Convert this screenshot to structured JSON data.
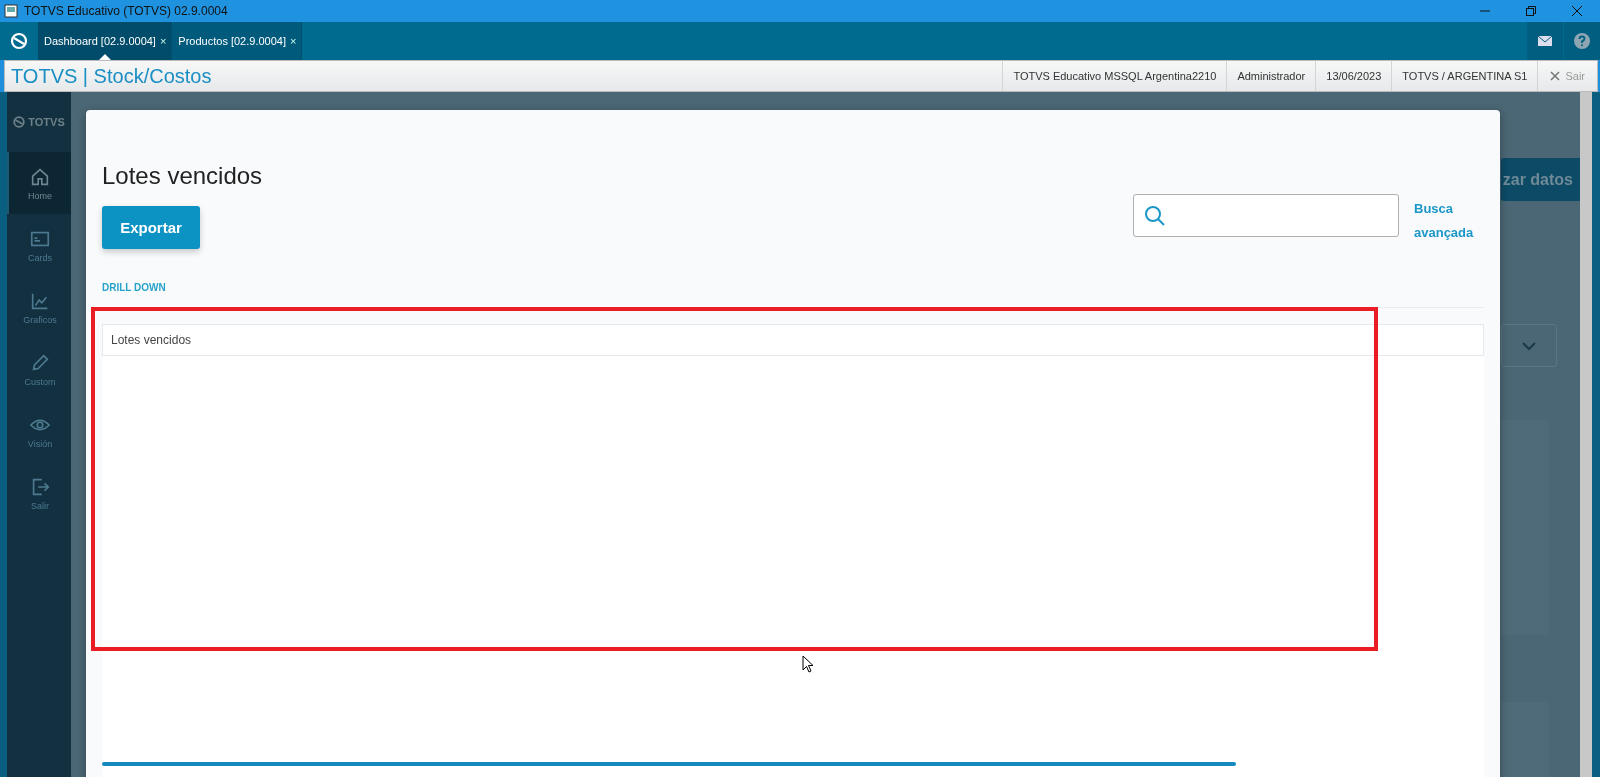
{
  "window": {
    "title": "TOTVS Educativo (TOTVS) 02.9.0004"
  },
  "tabs": [
    {
      "label": "Dashboard [02.9.0004]",
      "close": "×",
      "selected": true
    },
    {
      "label": "Productos [02.9.0004]",
      "close": "×",
      "selected": false
    }
  ],
  "header": {
    "app_title": "TOTVS | Stock/Costos",
    "info": [
      "TOTVS Educativo MSSQL Argentina2210",
      "Administrador",
      "13/06/2023",
      "TOTVS / ARGENTINA S1"
    ],
    "logout": "Sair"
  },
  "sidebar": {
    "logo": "TOTVS",
    "items": [
      {
        "kind": "home",
        "label": "Home",
        "selected": true
      },
      {
        "kind": "cards",
        "label": "Cards",
        "selected": false
      },
      {
        "kind": "chart",
        "label": "Graficos",
        "selected": false
      },
      {
        "kind": "pencil",
        "label": "Custom",
        "selected": false
      },
      {
        "kind": "eye",
        "label": "Visión",
        "selected": false
      },
      {
        "kind": "exit",
        "label": "Salir",
        "selected": false
      }
    ]
  },
  "background": {
    "button_fragment": "zar datos"
  },
  "modal": {
    "title": "Lotes vencidos",
    "export_button": "Exportar",
    "advanced_search": "Busca avançada",
    "section_label": "DRILL DOWN",
    "panel": {
      "title": "Lotes vencidos"
    }
  }
}
